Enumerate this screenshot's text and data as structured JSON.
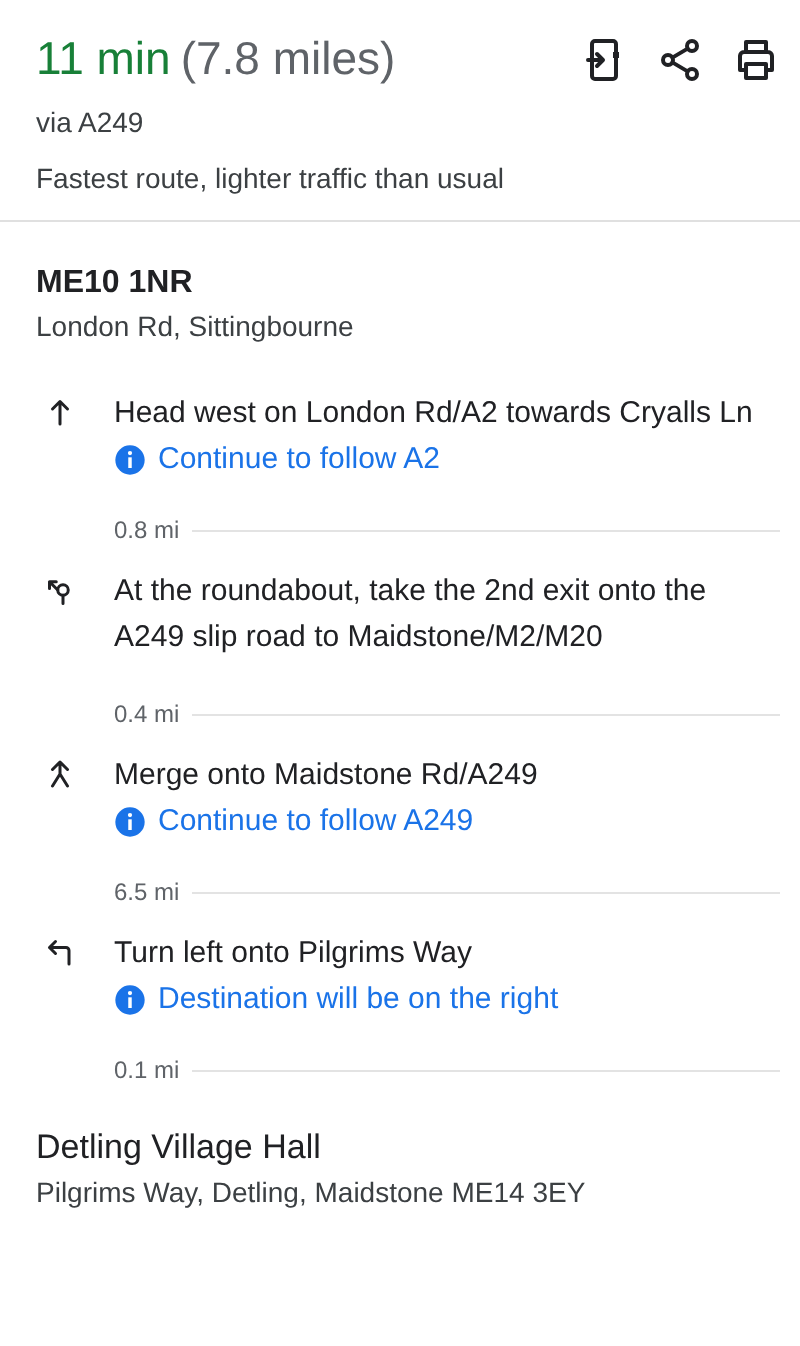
{
  "summary": {
    "duration": "11 min",
    "distance": "(7.8 miles)",
    "via": "via A249",
    "description": "Fastest route, lighter traffic than usual"
  },
  "origin": {
    "name": "ME10 1NR",
    "address": "London Rd, Sittingbourne"
  },
  "steps": [
    {
      "kind": "straight",
      "instruction": "Head west on London Rd/A2 towards Cryalls Ln",
      "note": "Continue to follow A2",
      "distance": "0.8 mi"
    },
    {
      "kind": "roundabout",
      "instruction": "At the roundabout, take the 2nd exit onto the A249 slip road to Maidstone/M2/M20",
      "distance": "0.4 mi"
    },
    {
      "kind": "merge",
      "instruction": "Merge onto Maidstone Rd/A249",
      "note": "Continue to follow A249",
      "distance": "6.5 mi"
    },
    {
      "kind": "turn-left",
      "instruction": "Turn left onto Pilgrims Way",
      "note": "Destination will be on the right",
      "distance": "0.1 mi"
    }
  ],
  "destination": {
    "name": "Detling Village Hall",
    "address": "Pilgrims Way, Detling, Maidstone ME14 3EY"
  }
}
